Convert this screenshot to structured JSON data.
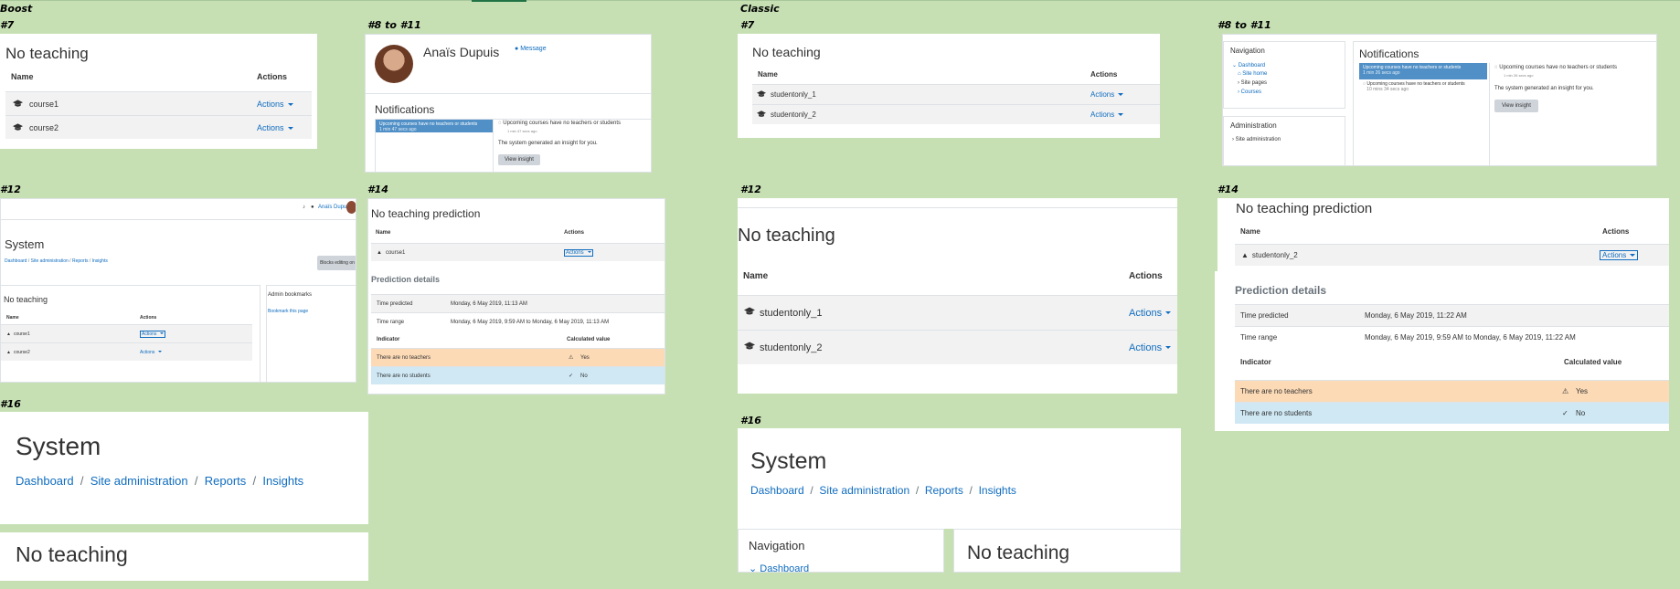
{
  "labels": {
    "boost": "Boost",
    "classic": "Classic",
    "s7a": "#7",
    "s8a": "#8 to #11",
    "s12a": "#12",
    "s14a": "#14",
    "s16a": "#16",
    "s7b": "#7",
    "s8b": "#8 to #11",
    "s12b": "#12",
    "s14b": "#14",
    "s16b": "#16"
  },
  "common": {
    "no_teaching": "No teaching",
    "no_teaching_prediction": "No teaching prediction",
    "name": "Name",
    "actions": "Actions",
    "notifications": "Notifications",
    "prediction_details": "Prediction details",
    "time_predicted": "Time predicted",
    "time_range": "Time range",
    "indicator": "Indicator",
    "calculated_value": "Calculated value",
    "no_teachers": "There are no teachers",
    "no_students": "There are no students",
    "yes": "Yes",
    "no": "No",
    "insight_title": "Upcoming courses have no teachers or students",
    "insight_body": "The system generated an insight for you.",
    "view_insight": "View insight",
    "system": "System",
    "navigation": "Navigation",
    "dashboard": "Dashboard",
    "site_home": "Site home",
    "site_pages": "Site pages",
    "courses": "Courses",
    "administration": "Administration",
    "site_administration": "Site administration",
    "reports": "Reports",
    "insights": "Insights",
    "admin_bookmarks": "Admin bookmarks",
    "bookmark_page": "Bookmark this page",
    "blocks_editing_on": "Blocks editing on",
    "message": "Message"
  },
  "boost": {
    "courses": [
      "course1",
      "course2"
    ],
    "user_name": "Anaïs Dupuis",
    "notif_time_1": "1 min 47 secs ago",
    "notif_time_2": "1 min 47 secs ago",
    "pred_course": "course1",
    "time_predicted_value": "Monday, 6 May 2019, 11:13 AM",
    "time_range_value": "Monday, 6 May 2019, 9:59 AM to Monday, 6 May 2019, 11:13 AM"
  },
  "classic": {
    "courses": [
      "studentonly_1",
      "studentonly_2"
    ],
    "notif_time_1": "1 min 26 secs ago",
    "notif_time_2": "1 min 26 secs ago",
    "notif_time_3": "10 mins 34 secs ago",
    "pred_course": "studentonly_2",
    "time_predicted_value": "Monday, 6 May 2019, 11:22 AM",
    "time_range_value": "Monday, 6 May 2019, 9:59 AM to Monday, 6 May 2019, 11:22 AM"
  },
  "colors": {
    "background": "#c6e0b4",
    "link": "#0f6cbf",
    "notif_blue": "#5090c7",
    "warning_row": "#fcdab6",
    "info_row": "#cfe8f4"
  }
}
